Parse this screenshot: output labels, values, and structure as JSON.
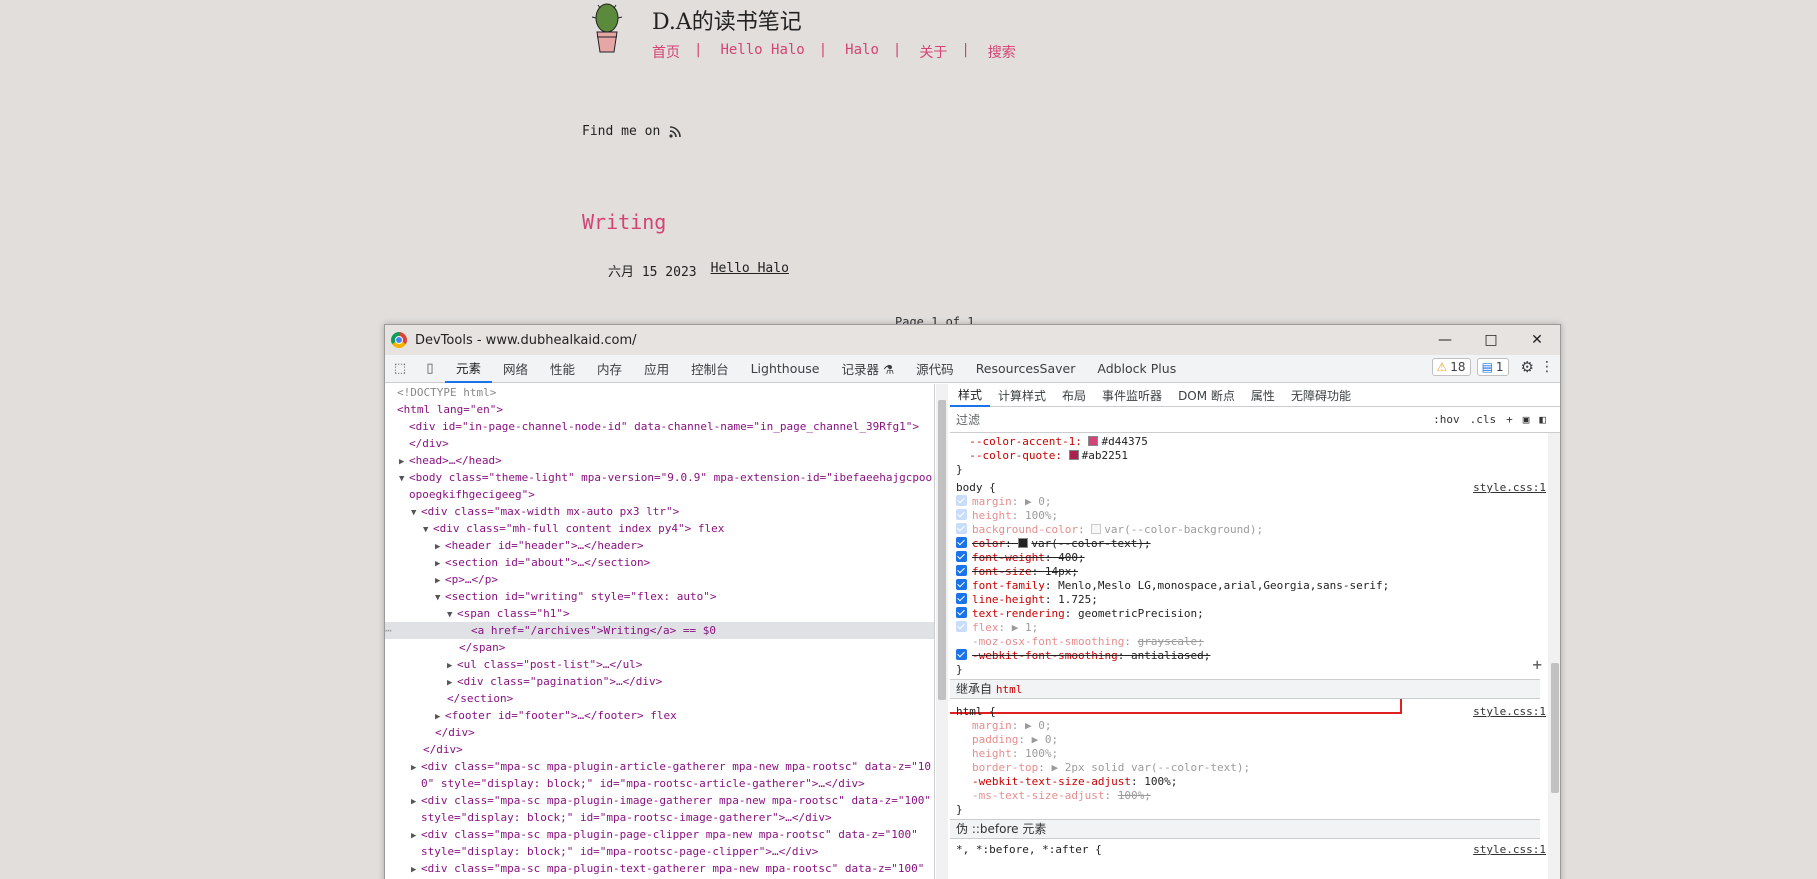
{
  "site": {
    "title": "D.A的读书笔记",
    "nav": [
      "首页",
      "Hello Halo",
      "Halo",
      "关于",
      "搜索"
    ],
    "find_me": "Find me on",
    "section_title": "Writing",
    "post_date": "六月 15 2023",
    "post_title": "Hello Halo",
    "pagination": "Page 1 of 1",
    "accent": "#d44375"
  },
  "devtools": {
    "window_title": "DevTools - www.dubhealkaid.com/",
    "tabs": [
      "元素",
      "网络",
      "性能",
      "内存",
      "应用",
      "控制台",
      "Lighthouse",
      "记录器 ⚗",
      "源代码",
      "ResourcesSaver",
      "Adblock Plus"
    ],
    "active_tab": "元素",
    "warnings": "18",
    "messages": "1",
    "dom": [
      "<!DOCTYPE html>",
      "<html lang=\"en\">",
      "<div id=\"in-page-channel-node-id\" data-channel-name=\"in_page_channel_39Rfg1\">",
      "</div>",
      "<head>…</head>",
      "<body class=\"theme-light\" mpa-version=\"9.0.9\" mpa-extension-id=\"ibefaeehajgcpoo",
      "opoegkifhgecigeeg\">",
      "<div class=\"max-width mx-auto px3 ltr\">",
      "<div class=\"mh-full content index py4\"> flex",
      "<header id=\"header\">…</header>",
      "<section id=\"about\">…</section>",
      "<p>…</p>",
      "<section id=\"writing\" style=\"flex: auto\">",
      "<span class=\"h1\">",
      "<a href=\"/archives\">Writing</a> == $0",
      "</span>",
      "<ul class=\"post-list\">…</ul>",
      "<div class=\"pagination\">…</div>",
      "</section>",
      "<footer id=\"footer\">…</footer> flex",
      "</div>",
      "</div>",
      "<div class=\"mpa-sc mpa-plugin-article-gatherer mpa-new mpa-rootsc\" data-z=\"10",
      "0\" style=\"display: block;\" id=\"mpa-rootsc-article-gatherer\">…</div>",
      "<div class=\"mpa-sc mpa-plugin-image-gatherer mpa-new mpa-rootsc\" data-z=\"100\"",
      "style=\"display: block;\" id=\"mpa-rootsc-image-gatherer\">…</div>",
      "<div class=\"mpa-sc mpa-plugin-page-clipper mpa-new mpa-rootsc\" data-z=\"100\"",
      "style=\"display: block;\" id=\"mpa-rootsc-page-clipper\">…</div>",
      "<div class=\"mpa-sc mpa-plugin-text-gatherer mpa-new mpa-rootsc\" data-z=\"100\""
    ],
    "style_tabs": [
      "样式",
      "计算样式",
      "布局",
      "事件监听器",
      "DOM 断点",
      "属性",
      "无障碍功能"
    ],
    "filter_placeholder": "过滤",
    "filter_tools": [
      ":hov",
      ".cls",
      "+"
    ],
    "vars": {
      "accent1_name": "--color-accent-1:",
      "accent1_value": "#d44375",
      "quote_name": "--color-quote:",
      "quote_value": "#ab2251"
    },
    "body_rule": {
      "selector": "body {",
      "source": "style.css:1",
      "props": [
        {
          "name": "margin",
          "value": "▶ 0;"
        },
        {
          "name": "height",
          "value": "100%;"
        },
        {
          "name": "background-color",
          "value": "var(--color-background);"
        },
        {
          "name": "color",
          "value": "var(--color-text);"
        },
        {
          "name": "font-weight",
          "value": "400;"
        },
        {
          "name": "font-size",
          "value": "14px;"
        },
        {
          "name": "font-family",
          "value": "Menlo,Meslo LG,monospace,arial,Georgia,sans-serif;"
        },
        {
          "name": "line-height",
          "value": "1.725;"
        },
        {
          "name": "text-rendering",
          "value": "geometricPrecision;"
        },
        {
          "name": "flex",
          "value": "▶ 1;"
        },
        {
          "name": "-moz-osx-font-smoothing",
          "value": "grayscale;"
        },
        {
          "name": "-webkit-font-smoothing",
          "value": "antialiased;"
        }
      ]
    },
    "inherited_label": "继承自",
    "inherited_from": "html",
    "html_rule": {
      "selector": "html {",
      "source": "style.css:1",
      "props": [
        {
          "name": "margin",
          "value": "▶ 0;"
        },
        {
          "name": "padding",
          "value": "▶ 0;"
        },
        {
          "name": "height",
          "value": "100%;"
        },
        {
          "name": "border-top",
          "value": "▶ 2px solid var(--color-text);"
        },
        {
          "name": "-webkit-text-size-adjust",
          "value": "100%;"
        },
        {
          "name": "-ms-text-size-adjust",
          "value": "100%;"
        }
      ]
    },
    "pseudo_label": "伪 ::before 元素",
    "pseudo_selector": "*, *:before, *:after {",
    "pseudo_source": "style.css:1"
  }
}
